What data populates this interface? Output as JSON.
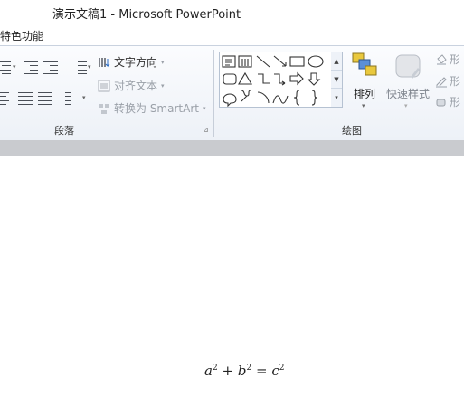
{
  "window": {
    "title": "演示文稿1  -  Microsoft PowerPoint"
  },
  "tabs": {
    "special": "特色功能"
  },
  "paragraph_group": {
    "label": "段落",
    "text_direction": "文字方向",
    "align_text": "对齐文本",
    "convert_smartart": "转换为 SmartArt"
  },
  "drawing_group": {
    "label": "绘图",
    "arrange": "排列",
    "quick_styles": "快速样式",
    "shape_fill": "形",
    "shape_outline": "形",
    "shape_effects": "形"
  },
  "slide": {
    "equation": {
      "a": "a",
      "b": "b",
      "c": "c",
      "exp_a": "2",
      "exp_b": "2",
      "exp_c": "2",
      "plus": "+",
      "equals": "="
    }
  },
  "colors": {
    "ribbon_bg": "#edf1f7",
    "accent": "#2b6cc4",
    "gray_band": "#c9cbcf"
  }
}
